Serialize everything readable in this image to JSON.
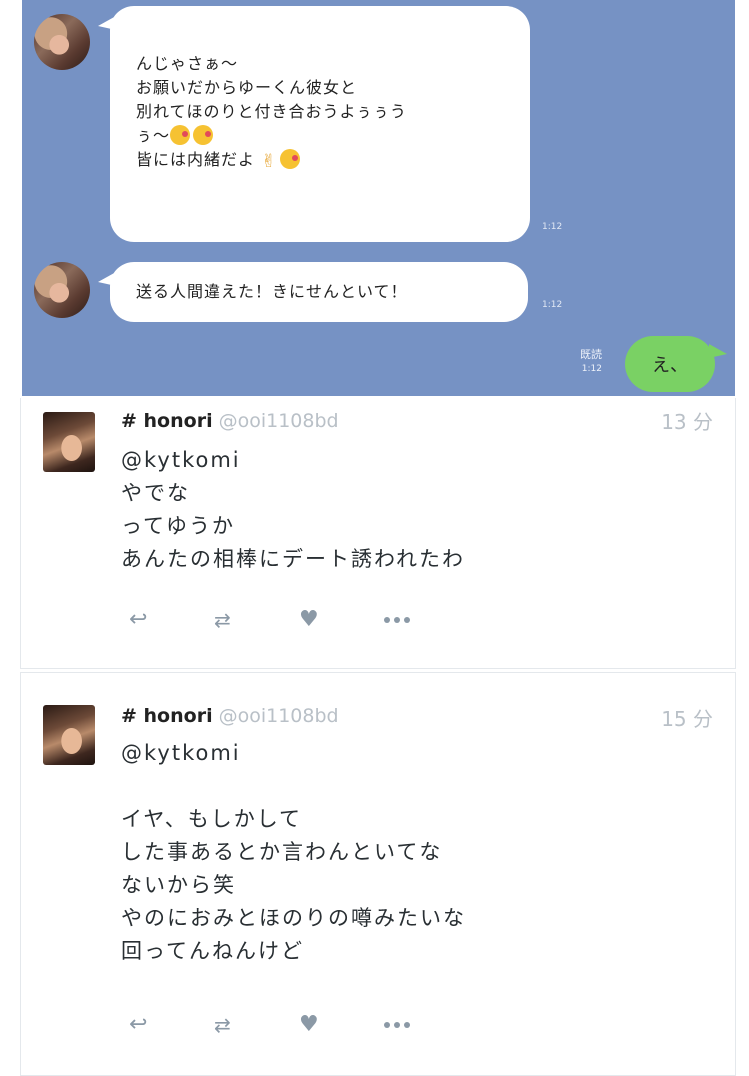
{
  "line_chat": {
    "colors": {
      "background": "#7692c4",
      "incoming_bubble": "#ffffff",
      "outgoing_bubble": "#7ad164"
    },
    "message1": {
      "lines": [
        "んじゃさぁ〜",
        "お願いだからゆーくん彼女と",
        "別れてほのりと付き合おうよぅぅう",
        "ぅ〜",
        "皆には内緒だよ"
      ],
      "emoji": [
        "kissing-face",
        "kissing-face",
        "victory-hand",
        "kissing-face"
      ],
      "time": "1:12"
    },
    "message2": {
      "text": "送る人間違えた！きにせんといて！",
      "time": "1:12"
    },
    "reply": {
      "text": "え、",
      "read_label": "既読",
      "time": "1:12"
    }
  },
  "tweets": [
    {
      "name": "# honori",
      "handle": "@ooi1108bd",
      "time": "13 分",
      "text": "@kytkomi\nやでな\nってゆうか\nあんたの相棒にデート誘われたわ"
    },
    {
      "name": "# honori",
      "handle": "@ooi1108bd",
      "time": "15 分",
      "text": "@kytkomi\n\nイヤ、もしかして\nした事あるとか言わんといてな\nないから笑\nやのにおみとほのりの噂みたいな\n回ってんねんけど"
    }
  ],
  "actions": {
    "reply_icon": "reply-icon",
    "retweet_icon": "retweet-icon",
    "like_icon": "heart-icon",
    "more_icon": "more-icon"
  }
}
